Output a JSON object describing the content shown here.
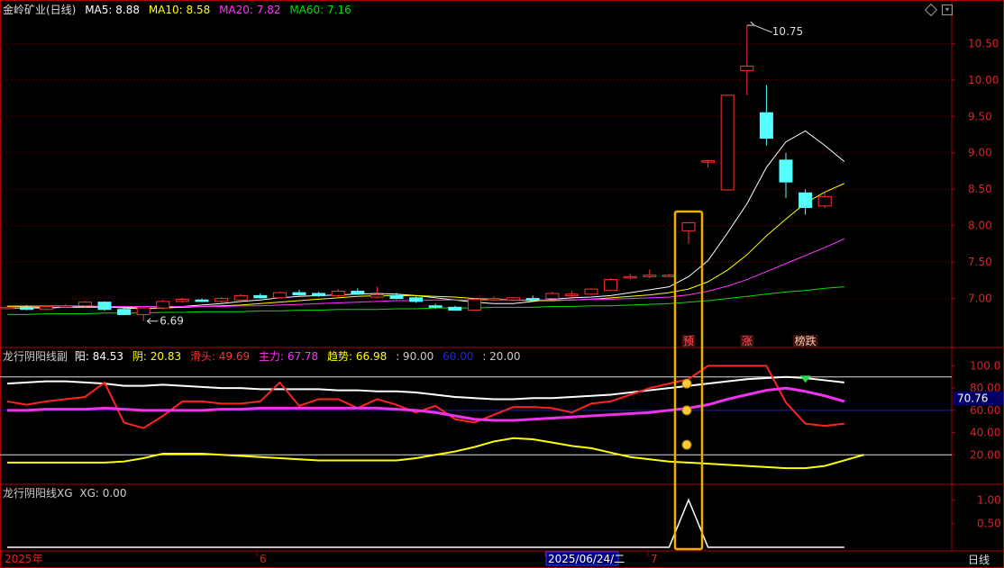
{
  "main_panel": {
    "stock_label": "金岭矿业(日线)",
    "indicators": [
      {
        "text": "MA5: 8.88",
        "color": "#ffffff"
      },
      {
        "text": "MA10: 8.58",
        "color": "#ffff00"
      },
      {
        "text": "MA20: 7.82",
        "color": "#ff33ff"
      },
      {
        "text": "MA60: 7.16",
        "color": "#00e000"
      }
    ]
  },
  "osc_panel": {
    "title": "龙行阴阳线副",
    "items": [
      {
        "text": "阳: 84.53",
        "color": "#ffffff"
      },
      {
        "text": "阴: 20.83",
        "color": "#ffff00"
      },
      {
        "text": "滑头: 49.69",
        "color": "#ff3333"
      },
      {
        "text": "主力: 67.78",
        "color": "#ff33ff"
      },
      {
        "text": "趋势: 66.98",
        "color": "#ffff00"
      },
      {
        "text": ": 90.00",
        "color": "#cccccc"
      },
      {
        "text": "60.00",
        "color": "#2222dd"
      },
      {
        "text": ": 20.00",
        "color": "#cccccc"
      }
    ],
    "cursor_value": "70.76"
  },
  "xg_panel": {
    "title": "龙行阴阳线XG",
    "xg_label": "XG: 0.00"
  },
  "signal_labels": [
    "预",
    "涨",
    "榜跌"
  ],
  "x_axis": {
    "labels": [
      "2025年",
      "6",
      "2025/06/24/二",
      "7"
    ],
    "period_label": "日线"
  },
  "chart_data": [
    {
      "type": "candlestick",
      "title": "金岭矿业(日线)",
      "ylim": [
        6.6,
        10.85
      ],
      "y_ticks": [
        "10.50",
        "10.00",
        "9.50",
        "9.00",
        "8.50",
        "8.00",
        "7.50",
        "7.00"
      ],
      "annotations": [
        "10.75",
        "6.69"
      ],
      "candles": [
        [
          6.86,
          6.89,
          6.85,
          6.88
        ],
        [
          6.88,
          6.91,
          6.84,
          6.85
        ],
        [
          6.85,
          6.9,
          6.84,
          6.89
        ],
        [
          6.89,
          6.92,
          6.87,
          6.9
        ],
        [
          6.9,
          6.97,
          6.88,
          6.95
        ],
        [
          6.95,
          6.96,
          6.83,
          6.85
        ],
        [
          6.85,
          6.87,
          6.77,
          6.78
        ],
        [
          6.78,
          6.9,
          6.69,
          6.87
        ],
        [
          6.87,
          6.98,
          6.85,
          6.96
        ],
        [
          6.96,
          7.01,
          6.94,
          6.99
        ],
        [
          6.98,
          7.0,
          6.95,
          6.96
        ],
        [
          6.96,
          7.02,
          6.94,
          7.0
        ],
        [
          6.98,
          7.06,
          6.96,
          7.04
        ],
        [
          7.04,
          7.07,
          7.0,
          7.01
        ],
        [
          7.01,
          7.1,
          7.0,
          7.08
        ],
        [
          7.08,
          7.12,
          7.04,
          7.05
        ],
        [
          7.07,
          7.09,
          7.02,
          7.04
        ],
        [
          7.04,
          7.13,
          7.02,
          7.1
        ],
        [
          7.1,
          7.14,
          7.05,
          7.06
        ],
        [
          7.02,
          7.16,
          7.0,
          7.05
        ],
        [
          7.04,
          7.08,
          6.99,
          7.0
        ],
        [
          7.01,
          7.03,
          6.94,
          6.96
        ],
        [
          6.9,
          6.93,
          6.86,
          6.88
        ],
        [
          6.88,
          6.9,
          6.84,
          6.84
        ],
        [
          6.84,
          7.0,
          6.83,
          6.99
        ],
        [
          6.99,
          7.03,
          6.98,
          7.0
        ],
        [
          6.98,
          7.02,
          6.96,
          7.01
        ],
        [
          7.0,
          7.04,
          6.98,
          6.99
        ],
        [
          7.0,
          7.09,
          6.99,
          7.07
        ],
        [
          7.04,
          7.1,
          7.02,
          7.06
        ],
        [
          7.06,
          7.14,
          7.05,
          7.13
        ],
        [
          7.11,
          7.28,
          7.1,
          7.26
        ],
        [
          7.3,
          7.34,
          7.26,
          7.3
        ],
        [
          7.3,
          7.4,
          7.28,
          7.32
        ],
        [
          7.31,
          7.34,
          7.3,
          7.32
        ],
        [
          7.93,
          8.05,
          7.75,
          8.04
        ],
        [
          8.88,
          8.91,
          8.8,
          8.89
        ],
        [
          8.49,
          9.79,
          8.48,
          9.79
        ],
        [
          10.13,
          10.75,
          9.79,
          10.19
        ],
        [
          9.55,
          9.93,
          9.1,
          9.2
        ],
        [
          8.9,
          9.0,
          8.38,
          8.6
        ],
        [
          8.45,
          8.5,
          8.15,
          8.25
        ],
        [
          8.27,
          8.45,
          8.24,
          8.4
        ]
      ],
      "series": [
        {
          "name": "MA5",
          "values": [
            6.87,
            6.87,
            6.87,
            6.88,
            6.89,
            6.89,
            6.87,
            6.86,
            6.87,
            6.89,
            6.91,
            6.93,
            6.96,
            6.98,
            7.01,
            7.03,
            7.04,
            7.05,
            7.06,
            7.07,
            7.06,
            7.04,
            7.01,
            6.98,
            6.95,
            6.93,
            6.93,
            6.96,
            6.99,
            7.01,
            7.02,
            7.04,
            7.08,
            7.12,
            7.16,
            7.3,
            7.52,
            7.9,
            8.3,
            8.8,
            9.15,
            9.3,
            9.1,
            8.88
          ]
        },
        {
          "name": "MA10",
          "values": [
            6.89,
            6.89,
            6.88,
            6.88,
            6.88,
            6.88,
            6.88,
            6.87,
            6.87,
            6.88,
            6.89,
            6.9,
            6.91,
            6.93,
            6.95,
            6.97,
            6.99,
            7.01,
            7.03,
            7.04,
            7.04,
            7.04,
            7.03,
            7.02,
            7.0,
            6.99,
            6.98,
            6.97,
            6.97,
            6.98,
            6.99,
            7.01,
            7.03,
            7.05,
            7.08,
            7.13,
            7.23,
            7.39,
            7.6,
            7.86,
            8.09,
            8.31,
            8.46,
            8.58
          ]
        },
        {
          "name": "MA20",
          "values": [
            6.9,
            6.9,
            6.9,
            6.9,
            6.9,
            6.89,
            6.89,
            6.89,
            6.89,
            6.89,
            6.89,
            6.89,
            6.9,
            6.9,
            6.91,
            6.92,
            6.93,
            6.94,
            6.95,
            6.96,
            6.97,
            6.97,
            6.98,
            6.98,
            6.98,
            6.98,
            6.98,
            6.98,
            6.98,
            6.98,
            6.99,
            6.99,
            7.0,
            7.01,
            7.02,
            7.05,
            7.1,
            7.17,
            7.26,
            7.37,
            7.48,
            7.59,
            7.7,
            7.82
          ]
        },
        {
          "name": "MA60",
          "values": [
            6.78,
            6.78,
            6.79,
            6.79,
            6.79,
            6.8,
            6.8,
            6.8,
            6.81,
            6.81,
            6.82,
            6.82,
            6.82,
            6.83,
            6.83,
            6.84,
            6.84,
            6.85,
            6.85,
            6.85,
            6.86,
            6.86,
            6.87,
            6.87,
            6.87,
            6.88,
            6.88,
            6.88,
            6.89,
            6.89,
            6.9,
            6.9,
            6.91,
            6.92,
            6.93,
            6.95,
            6.97,
            7.0,
            7.03,
            7.06,
            7.09,
            7.11,
            7.14,
            7.16
          ]
        }
      ]
    },
    {
      "type": "line",
      "title": "龙行阴阳线副",
      "ylim": [
        0,
        110
      ],
      "y_ticks": [
        "100.0",
        "80.00",
        "60.00",
        "40.00",
        "20.00"
      ],
      "reference_lines": [
        90,
        60,
        20
      ],
      "series": [
        {
          "name": "阳",
          "values": [
            84,
            85,
            86,
            86,
            85,
            84,
            82,
            82,
            83,
            82,
            81,
            80,
            80,
            79,
            79,
            79,
            79,
            78,
            78,
            77,
            77,
            76,
            74,
            72,
            71,
            70,
            70,
            71,
            71,
            72,
            73,
            74,
            76,
            78,
            80,
            82,
            84,
            86,
            88,
            89,
            90,
            89,
            87,
            85
          ]
        },
        {
          "name": "阴",
          "values": [
            13,
            13,
            13,
            13,
            13,
            13,
            14,
            17,
            21,
            21,
            21,
            20,
            19,
            18,
            17,
            16,
            15,
            15,
            15,
            15,
            15,
            17,
            20,
            23,
            27,
            32,
            35,
            34,
            31,
            28,
            26,
            22,
            18,
            16,
            14,
            13,
            12,
            11,
            10,
            9,
            8,
            8,
            10,
            15,
            20
          ]
        },
        {
          "name": "滑头",
          "values": [
            68,
            65,
            68,
            70,
            72,
            85,
            49,
            44,
            55,
            68,
            68,
            66,
            66,
            68,
            85,
            64,
            70,
            70,
            62,
            70,
            65,
            58,
            64,
            52,
            49,
            56,
            63,
            63,
            62,
            58,
            66,
            68,
            74,
            80,
            84,
            88,
            100,
            100,
            100,
            100,
            67,
            48,
            46,
            48
          ]
        },
        {
          "name": "主力",
          "values": [
            60,
            60,
            61,
            61,
            61,
            62,
            61,
            60,
            60,
            60,
            60,
            61,
            61,
            62,
            62,
            62,
            62,
            62,
            62,
            62,
            61,
            60,
            58,
            55,
            52,
            51,
            51,
            52,
            53,
            54,
            55,
            56,
            57,
            58,
            60,
            62,
            65,
            70,
            74,
            78,
            80,
            77,
            73,
            68
          ]
        }
      ],
      "signal_markers": [
        84,
        60,
        29
      ]
    },
    {
      "type": "line",
      "title": "龙行阴阳线XG",
      "ylim": [
        0,
        1.1
      ],
      "y_ticks": [
        "1.00",
        "0.50"
      ],
      "series": [
        {
          "name": "XG",
          "values": [
            0,
            0,
            0,
            0,
            0,
            0,
            0,
            0,
            0,
            0,
            0,
            0,
            0,
            0,
            0,
            0,
            0,
            0,
            0,
            0,
            0,
            0,
            0,
            0,
            0,
            0,
            0,
            0,
            0,
            0,
            0,
            0,
            0,
            0,
            0,
            1,
            0,
            0,
            0,
            0,
            0,
            0,
            0,
            0
          ]
        }
      ]
    }
  ]
}
